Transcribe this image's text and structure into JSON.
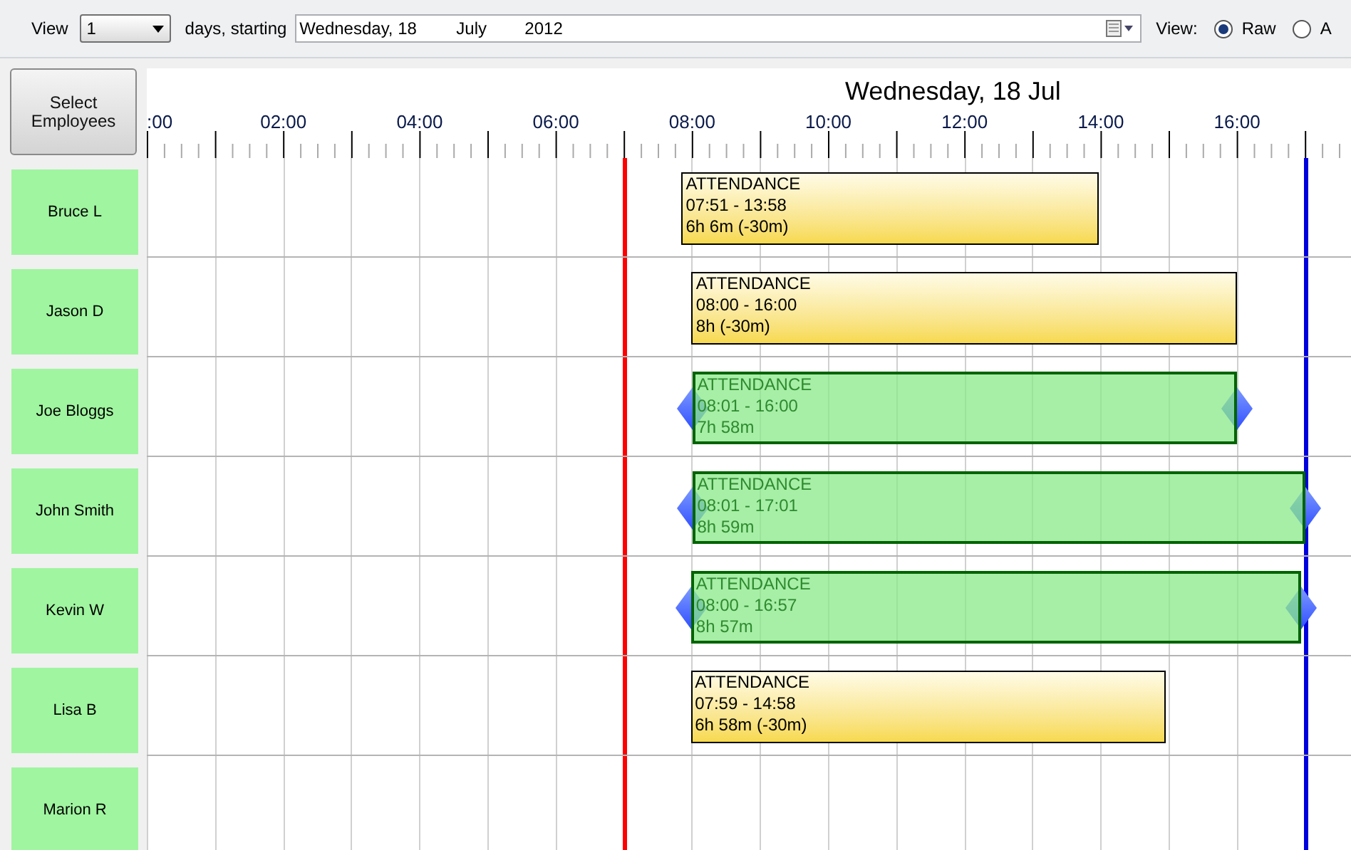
{
  "control_bar": {
    "view_label": "View",
    "days_select": {
      "value": "1"
    },
    "days_label": "days, starting",
    "date_field": {
      "weekday_day": "Wednesday, 18",
      "month": "July",
      "year": "2012"
    },
    "view_mode_label": "View:",
    "view_modes": [
      {
        "label": "Raw",
        "selected": true
      },
      {
        "label": "A",
        "selected": false
      }
    ]
  },
  "select_employees_button": "Select Employees",
  "timeline": {
    "date_title": "Wednesday, 18 Jul",
    "hour_labels": [
      ":00",
      "02:00",
      "04:00",
      "06:00",
      "08:00",
      "10:00",
      "12:00",
      "14:00",
      "16:00"
    ],
    "markers": [
      {
        "color": "#ff0000"
      },
      {
        "color": "#0000dd"
      }
    ]
  },
  "employees": [
    {
      "name": "Bruce L",
      "events": [
        {
          "kind": "plain",
          "title": "ATTENDANCE",
          "time": "07:51 - 13:58",
          "duration": "6h 6m (-30m)"
        }
      ]
    },
    {
      "name": "Jason D",
      "events": [
        {
          "kind": "plain",
          "title": "ATTENDANCE",
          "time": "08:00 - 16:00",
          "duration": "8h (-30m)"
        }
      ]
    },
    {
      "name": "Joe Bloggs",
      "events": [
        {
          "kind": "editable",
          "title": "ATTENDANCE",
          "time": "08:01 - 16:00",
          "duration": "7h 58m"
        }
      ]
    },
    {
      "name": "John Smith",
      "events": [
        {
          "kind": "editable",
          "title": "ATTENDANCE",
          "time": "08:01 - 17:01",
          "duration": "8h 59m"
        }
      ]
    },
    {
      "name": "Kevin W",
      "events": [
        {
          "kind": "editable",
          "title": "ATTENDANCE",
          "time": "08:00 - 16:57",
          "duration": "8h 57m"
        }
      ]
    },
    {
      "name": "Lisa B",
      "events": [
        {
          "kind": "plain",
          "title": "ATTENDANCE",
          "time": "07:59 - 14:58",
          "duration": "6h 58m (-30m)"
        }
      ]
    },
    {
      "name": "Marion R"
    }
  ]
}
